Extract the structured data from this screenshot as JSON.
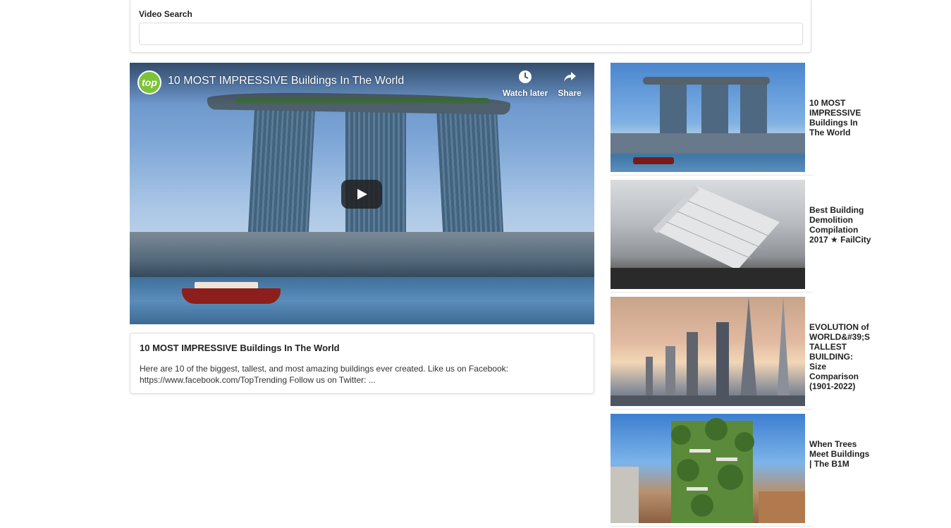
{
  "search": {
    "label": "Video Search",
    "value": "",
    "placeholder": ""
  },
  "player": {
    "channel_logo_text": "top",
    "title": "10 MOST IMPRESSIVE Buildings In The World",
    "watch_later_label": "Watch later",
    "share_label": "Share"
  },
  "description": {
    "title": "10 MOST IMPRESSIVE Buildings In The World",
    "text": "Here are 10 of the biggest, tallest, and most amazing buildings ever created. Like us on Facebook: https://www.facebook.com/TopTrending Follow us on Twitter: ..."
  },
  "sidebar": {
    "items": [
      {
        "title": "10 MOST IMPRESSIVE Buildings In The World"
      },
      {
        "title": "Best Building Demolition Compilation 2017 ★ FailCity"
      },
      {
        "title": "EVOLUTION of WORLD&#39;S TALLEST BUILDING: Size Comparison (1901-2022)"
      },
      {
        "title": "When Trees Meet Buildings | The B1M"
      }
    ]
  },
  "icons": {
    "watch_later": "clock-icon",
    "share": "share-arrow-icon",
    "play": "play-icon"
  }
}
